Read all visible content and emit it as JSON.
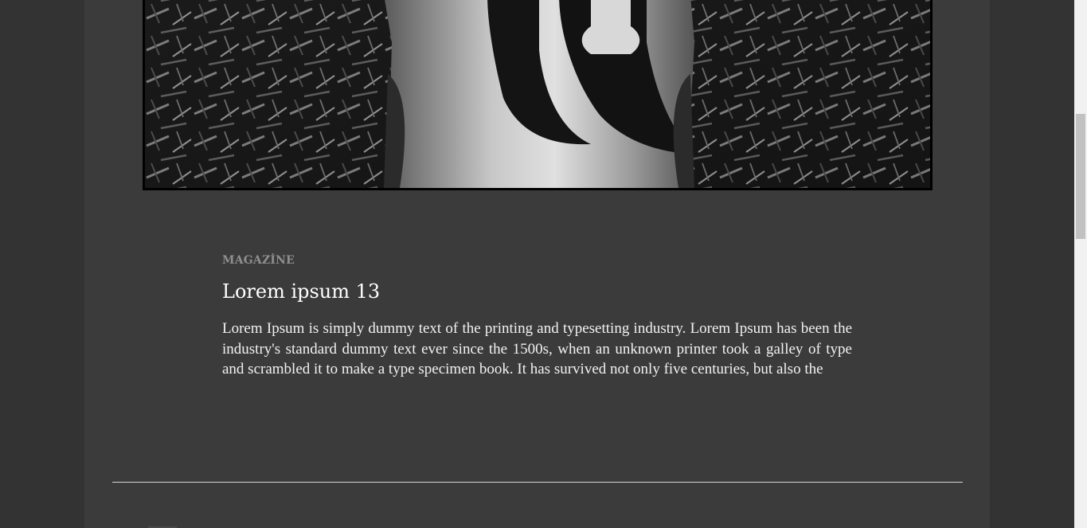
{
  "article": {
    "category": "MAGAZİNE",
    "title": "Lorem ipsum 13",
    "excerpt": "Lorem Ipsum is simply dummy text of the printing and typesetting industry. Lorem Ipsum has been the industry's standard dummy text ever since the 1500s, when an unknown printer took a galley of type and scrambled it to make a type specimen book. It has survived not only five centuries, but also the"
  },
  "colors": {
    "background": "#333333",
    "column": "#3b3b3b",
    "category_text": "#8f8f8f",
    "title_text": "#ffffff",
    "divider": "#d6d6d6"
  },
  "icons": {
    "hero": "photo-woman-in-bamboo"
  }
}
